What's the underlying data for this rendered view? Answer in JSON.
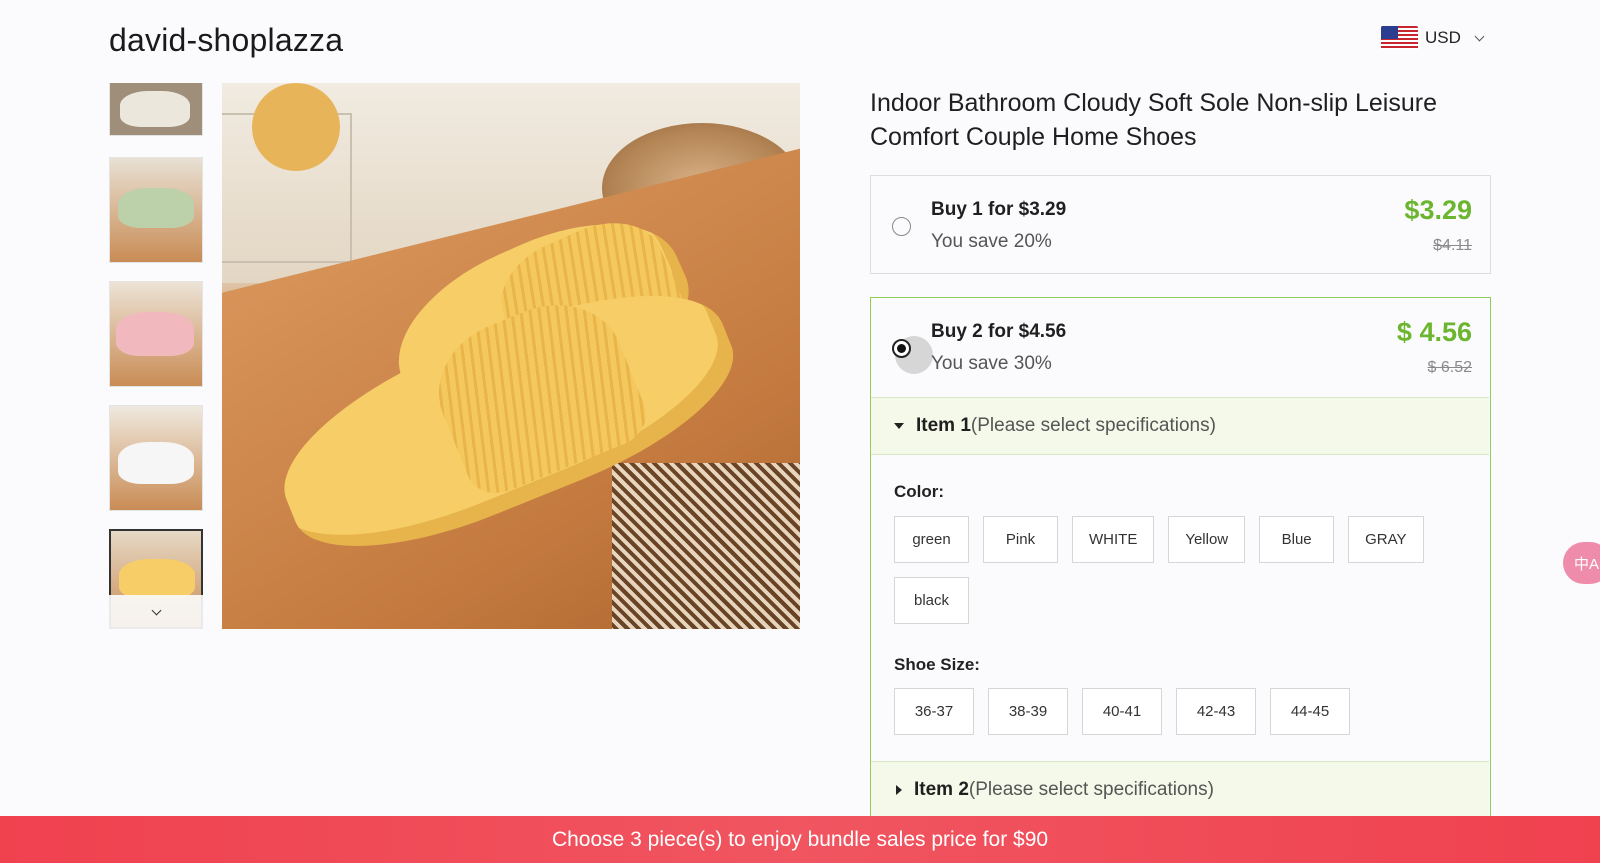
{
  "header": {
    "brand": "david-shoplazza",
    "currency": {
      "label": "USD",
      "flag_icon": "us-flag-icon"
    }
  },
  "gallery": {
    "thumbnails": [
      {
        "color": "#e9e4d8",
        "alt": "beige"
      },
      {
        "color": "#bcd0a9",
        "alt": "green"
      },
      {
        "color": "#f1b9be",
        "alt": "pink"
      },
      {
        "color": "#f2f2f2",
        "alt": "white"
      },
      {
        "color": "#f6cd67",
        "alt": "yellow",
        "selected": true
      }
    ],
    "main_color": "#f6cd67"
  },
  "product": {
    "title": "Indoor Bathroom Cloudy Soft Sole Non-slip Leisure Comfort Couple Home Shoes"
  },
  "bundles": [
    {
      "buy_label": "Buy 1 for $3.29",
      "save_label": "You save 20%",
      "price": "$3.29",
      "old_price": "$4.11",
      "selected": false
    },
    {
      "buy_label": "Buy 2 for $4.56",
      "save_label": "You save 30%",
      "price": "$ 4.56",
      "old_price": "$ 6.52",
      "selected": true
    }
  ],
  "items": [
    {
      "name": "Item 1",
      "hint": "(Please select specifications)",
      "expanded": true,
      "color_label": "Color:",
      "colors": [
        "green",
        "Pink",
        "WHITE",
        "Yellow",
        "Blue",
        "GRAY",
        "black"
      ],
      "size_label": "Shoe Size:",
      "sizes": [
        "36-37",
        "38-39",
        "40-41",
        "42-43",
        "44-45"
      ]
    },
    {
      "name": "Item 2",
      "hint": "(Please select specifications)",
      "expanded": false
    }
  ],
  "translate_widget": {
    "label": "中A",
    "color": "#f08cab"
  },
  "banner": {
    "text": "Choose 3 piece(s) to enjoy bundle sales price for $90",
    "color": "#f0414f"
  },
  "colors": {
    "accent_green": "#6bb52f",
    "selected_border": "#8fce5b"
  }
}
